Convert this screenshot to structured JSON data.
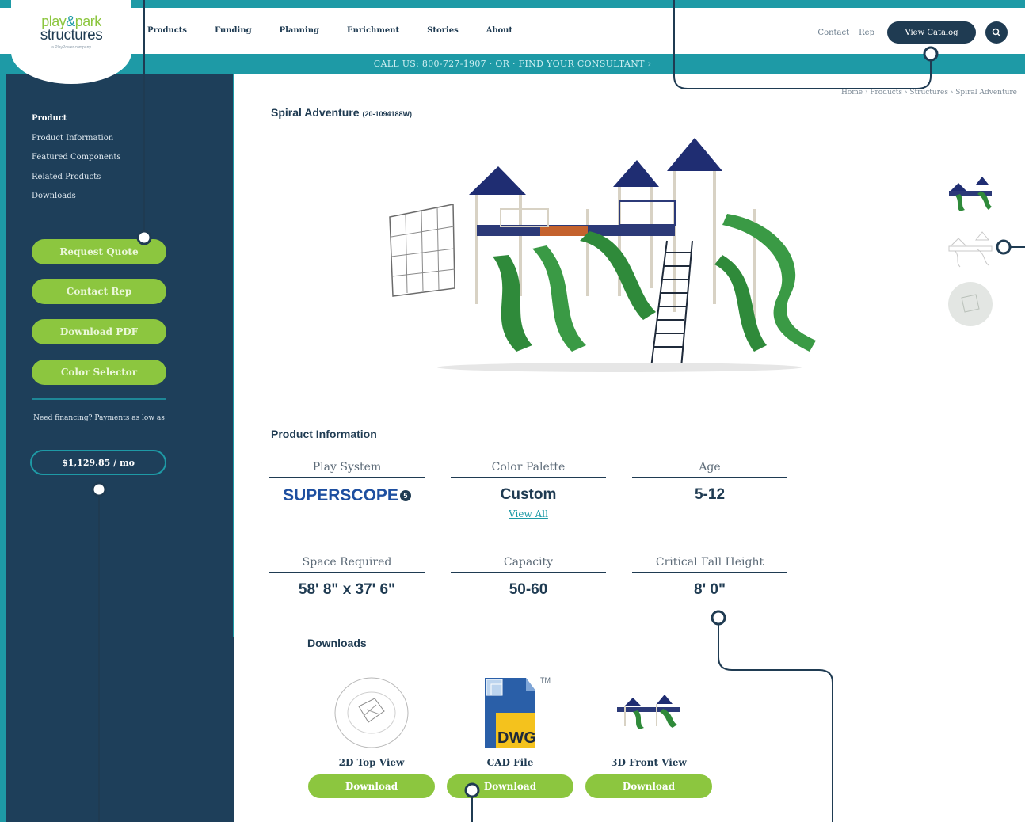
{
  "brand": {
    "logo_top_a": "play",
    "logo_top_amp": "&",
    "logo_top_b": "park",
    "logo_bottom": "structures",
    "logo_tag": "a PlayPower company"
  },
  "nav": {
    "items": [
      "Products",
      "Funding",
      "Planning",
      "Enrichment",
      "Stories",
      "About"
    ]
  },
  "utility": {
    "contact": "Contact",
    "rep": "Rep",
    "catalog": "View Catalog"
  },
  "callbar": "CALL US: 800-727-1907 · OR · FIND YOUR CONSULTANT ›",
  "sidebar": {
    "nav": [
      "Product",
      "Product Information",
      "Featured Components",
      "Related Products",
      "Downloads"
    ],
    "buttons": [
      "Request Quote",
      "Contact Rep",
      "Download PDF",
      "Color Selector"
    ],
    "finance_text": "Need financing? Payments as low as",
    "payment": "$1,129.85 / mo"
  },
  "breadcrumb": "Home › Products › Structures › Spiral Adventure",
  "product": {
    "name": "Spiral Adventure",
    "code": "(20-1094188W)"
  },
  "product_info": {
    "title": "Product Information",
    "specs": [
      {
        "label": "Play System",
        "value": "SUPERSCOPE"
      },
      {
        "label": "Color Palette",
        "value": "Custom",
        "link": "View All"
      },
      {
        "label": "Age",
        "value": "5-12"
      },
      {
        "label": "Space Required",
        "value": "58' 8\" x 37' 6\""
      },
      {
        "label": "Capacity",
        "value": "50-60"
      },
      {
        "label": "Critical Fall Height",
        "value": "8' 0\""
      }
    ]
  },
  "downloads": {
    "title": "Downloads",
    "items": [
      {
        "label": "2D Top View",
        "button": "Download"
      },
      {
        "label": "CAD File",
        "button": "Download",
        "badge": "DWG",
        "tm": "TM"
      },
      {
        "label": "3D Front View",
        "button": "Download"
      }
    ]
  },
  "colors": {
    "navy": "#1f3b52",
    "teal": "#1e9aa6",
    "green": "#8cc63f",
    "sidebar": "#1e3f5a"
  }
}
